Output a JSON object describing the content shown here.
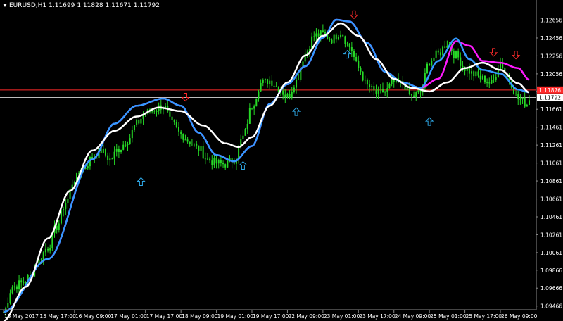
{
  "header": {
    "symbol": "EURUSD,H1",
    "open": "1.11699",
    "high": "1.11828",
    "low": "1.11671",
    "close": "1.11792"
  },
  "chart_data": {
    "type": "line",
    "instrument": "EURUSD",
    "timeframe": "H1",
    "ylim": [
      1.0944,
      1.1277
    ],
    "y_ticks": [
      "1.12656",
      "1.12456",
      "1.12256",
      "1.12056",
      "1.11861",
      "1.11661",
      "1.11461",
      "1.11261",
      "1.11061",
      "1.10861",
      "1.10661",
      "1.10461",
      "1.10261",
      "1.10061",
      "1.09866",
      "1.09666",
      "1.09466"
    ],
    "y_tick_values": [
      1.12656,
      1.12456,
      1.12256,
      1.12056,
      1.11861,
      1.11661,
      1.11461,
      1.11261,
      1.11061,
      1.10861,
      1.10661,
      1.10461,
      1.10261,
      1.10061,
      1.09866,
      1.09666,
      1.09466
    ],
    "x_ticks": [
      "15 May 2017",
      "15 May 17:00",
      "16 May 09:00",
      "17 May 01:00",
      "17 May 17:00",
      "18 May 09:00",
      "19 May 01:00",
      "19 May 17:00",
      "22 May 09:00",
      "23 May 01:00",
      "23 May 17:00",
      "24 May 09:00",
      "25 May 01:00",
      "25 May 17:00",
      "26 May 09:00"
    ],
    "x_tick_bars": [
      0,
      16,
      32,
      48,
      64,
      80,
      96,
      112,
      128,
      144,
      160,
      176,
      192,
      208,
      224
    ],
    "bar_count": 238,
    "price_label": "1.11792",
    "current_price": 1.11792,
    "hidden_price_label": "1.11876",
    "horizontal_levels": [
      {
        "value": 1.11876,
        "color": "#ff2b2b"
      },
      {
        "value": 1.11792,
        "color": "#bdbdbd"
      }
    ],
    "close_series": {
      "name": "",
      "knots": [
        [
          0,
          1.094
        ],
        [
          4,
          1.0968
        ],
        [
          8,
          1.0972
        ],
        [
          12,
          1.098
        ],
        [
          15,
          1.0995
        ],
        [
          20,
          1.1012
        ],
        [
          24,
          1.1035
        ],
        [
          28,
          1.1062
        ],
        [
          32,
          1.1088
        ],
        [
          36,
          1.11
        ],
        [
          40,
          1.1112
        ],
        [
          44,
          1.112
        ],
        [
          48,
          1.111
        ],
        [
          52,
          1.1122
        ],
        [
          56,
          1.1132
        ],
        [
          60,
          1.115
        ],
        [
          64,
          1.1162
        ],
        [
          68,
          1.1166
        ],
        [
          72,
          1.117
        ],
        [
          76,
          1.115
        ],
        [
          80,
          1.1138
        ],
        [
          84,
          1.113
        ],
        [
          88,
          1.1122
        ],
        [
          92,
          1.111
        ],
        [
          96,
          1.1106
        ],
        [
          100,
          1.1105
        ],
        [
          104,
          1.111
        ],
        [
          108,
          1.1135
        ],
        [
          112,
          1.117
        ],
        [
          116,
          1.1195
        ],
        [
          120,
          1.1198
        ],
        [
          124,
          1.119
        ],
        [
          128,
          1.118
        ],
        [
          132,
          1.1198
        ],
        [
          136,
          1.1228
        ],
        [
          140,
          1.1248
        ],
        [
          144,
          1.125
        ],
        [
          148,
          1.1244
        ],
        [
          152,
          1.1252
        ],
        [
          156,
          1.1236
        ],
        [
          160,
          1.1212
        ],
        [
          164,
          1.1192
        ],
        [
          168,
          1.1184
        ],
        [
          172,
          1.1186
        ],
        [
          176,
          1.1196
        ],
        [
          180,
          1.1194
        ],
        [
          184,
          1.118
        ],
        [
          188,
          1.1185
        ],
        [
          192,
          1.122
        ],
        [
          196,
          1.1228
        ],
        [
          200,
          1.124
        ],
        [
          204,
          1.1226
        ],
        [
          208,
          1.1212
        ],
        [
          212,
          1.1205
        ],
        [
          216,
          1.12
        ],
        [
          220,
          1.1195
        ],
        [
          224,
          1.1218
        ],
        [
          228,
          1.1198
        ],
        [
          232,
          1.1178
        ],
        [
          236,
          1.1172
        ],
        [
          237,
          1.1179
        ]
      ]
    },
    "series": [
      {
        "name": "",
        "color": "#ff19ff",
        "points": [
          [
            0,
            1.094
          ],
          [
            20,
            1.0999
          ],
          [
            40,
            1.111
          ],
          [
            50,
            1.115
          ],
          [
            60,
            1.117
          ],
          [
            72,
            1.1178
          ],
          [
            80,
            1.117
          ],
          [
            88,
            1.114
          ],
          [
            96,
            1.1115
          ],
          [
            104,
            1.1108
          ],
          [
            112,
            1.1125
          ],
          [
            120,
            1.1172
          ],
          [
            128,
            1.1194
          ],
          [
            136,
            1.1214
          ],
          [
            144,
            1.1246
          ],
          [
            150,
            1.1266
          ],
          [
            156,
            1.1264
          ],
          [
            164,
            1.124
          ],
          [
            172,
            1.1208
          ],
          [
            180,
            1.1196
          ],
          [
            188,
            1.119
          ],
          [
            196,
            1.12
          ],
          [
            204,
            1.1242
          ],
          [
            210,
            1.1237
          ],
          [
            216,
            1.122
          ],
          [
            224,
            1.1218
          ],
          [
            232,
            1.1212
          ],
          [
            237,
            1.1199
          ]
        ]
      },
      {
        "name": "",
        "color": "#3399ff",
        "points": [
          [
            0,
            1.094
          ],
          [
            20,
            1.0999
          ],
          [
            40,
            1.111
          ],
          [
            50,
            1.115
          ],
          [
            60,
            1.117
          ],
          [
            72,
            1.1178
          ],
          [
            80,
            1.117
          ],
          [
            88,
            1.114
          ],
          [
            96,
            1.1115
          ],
          [
            104,
            1.1108
          ],
          [
            112,
            1.1125
          ],
          [
            120,
            1.1172
          ],
          [
            128,
            1.1194
          ],
          [
            136,
            1.1214
          ],
          [
            144,
            1.1246
          ],
          [
            150,
            1.1266
          ],
          [
            156,
            1.1264
          ],
          [
            164,
            1.124
          ],
          [
            172,
            1.1208
          ],
          [
            180,
            1.1196
          ],
          [
            188,
            1.119
          ],
          [
            196,
            1.122
          ],
          [
            204,
            1.1245
          ],
          [
            210,
            1.1222
          ],
          [
            216,
            1.121
          ],
          [
            224,
            1.1206
          ],
          [
            232,
            1.1188
          ],
          [
            237,
            1.1185
          ]
        ]
      },
      {
        "name": "",
        "color": "#ffffff",
        "points": [
          [
            0,
            1.093
          ],
          [
            10,
            1.0968
          ],
          [
            20,
            1.1022
          ],
          [
            30,
            1.1075
          ],
          [
            40,
            1.112
          ],
          [
            50,
            1.1142
          ],
          [
            60,
            1.1158
          ],
          [
            70,
            1.1168
          ],
          [
            80,
            1.1164
          ],
          [
            90,
            1.1148
          ],
          [
            100,
            1.1128
          ],
          [
            106,
            1.1124
          ],
          [
            112,
            1.1135
          ],
          [
            120,
            1.117
          ],
          [
            128,
            1.1196
          ],
          [
            136,
            1.1226
          ],
          [
            144,
            1.1248
          ],
          [
            152,
            1.1262
          ],
          [
            160,
            1.1248
          ],
          [
            168,
            1.1222
          ],
          [
            176,
            1.12
          ],
          [
            184,
            1.119
          ],
          [
            192,
            1.1186
          ],
          [
            200,
            1.1196
          ],
          [
            208,
            1.1212
          ],
          [
            216,
            1.1218
          ],
          [
            224,
            1.121
          ],
          [
            232,
            1.1195
          ],
          [
            237,
            1.1185
          ]
        ]
      }
    ],
    "signals": [
      {
        "type": "up",
        "bar": 62,
        "price": 1.1085,
        "color": "#2ea8e6"
      },
      {
        "type": "down",
        "bar": 82,
        "price": 1.118,
        "color": "#ff2b2b"
      },
      {
        "type": "up",
        "bar": 108,
        "price": 1.1103,
        "color": "#2ea8e6"
      },
      {
        "type": "up",
        "bar": 132,
        "price": 1.1163,
        "color": "#2ea8e6"
      },
      {
        "type": "down",
        "bar": 158,
        "price": 1.1272,
        "color": "#ff2b2b"
      },
      {
        "type": "up",
        "bar": 155,
        "price": 1.1227,
        "color": "#2ea8e6"
      },
      {
        "type": "up",
        "bar": 192,
        "price": 1.1152,
        "color": "#2ea8e6"
      },
      {
        "type": "down",
        "bar": 221,
        "price": 1.123,
        "color": "#ff2b2b"
      },
      {
        "type": "down",
        "bar": 231,
        "price": 1.1227,
        "color": "#ff2b2b"
      }
    ],
    "colors": {
      "background": "#000000",
      "axis": "#8a8a8a",
      "text": "#ffffff",
      "candles": "#26d926",
      "price_label_bg": "#ffffff",
      "price_label_fg": "#000000",
      "hidden_price_label_bg": "#ff2b2b"
    }
  }
}
